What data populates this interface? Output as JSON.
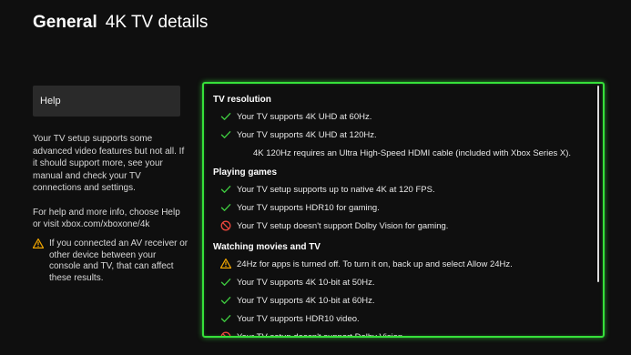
{
  "header": {
    "section": "General",
    "title": "4K TV details"
  },
  "sidebar": {
    "help_label": "Help",
    "paragraph1": "Your TV setup supports some advanced video features but not all. If it should support more, see your manual and check your TV connections and settings.",
    "paragraph2": "For help and more info, choose Help or visit xbox.com/xboxone/4k",
    "warning": "If you connected an AV receiver or other device between your console and TV, that can affect these results."
  },
  "groups": [
    {
      "title": "TV resolution",
      "items": [
        {
          "icon": "check",
          "text": "Your TV supports 4K UHD at 60Hz."
        },
        {
          "icon": "check",
          "text": "Your TV supports 4K UHD at 120Hz."
        },
        {
          "icon": "none",
          "text": "4K 120Hz requires an Ultra High-Speed HDMI cable (included with Xbox Series X)."
        }
      ]
    },
    {
      "title": "Playing games",
      "items": [
        {
          "icon": "check",
          "text": "Your TV setup supports up to native 4K at 120 FPS."
        },
        {
          "icon": "check",
          "text": "Your TV supports HDR10 for gaming."
        },
        {
          "icon": "block",
          "text": "Your TV setup doesn't support Dolby Vision for gaming."
        }
      ]
    },
    {
      "title": "Watching movies and TV",
      "items": [
        {
          "icon": "warning",
          "text": "24Hz for apps is turned off. To turn it on, back up and select Allow 24Hz."
        },
        {
          "icon": "check",
          "text": "Your TV supports 4K 10-bit at 50Hz."
        },
        {
          "icon": "check",
          "text": "Your TV supports 4K 10-bit at 60Hz."
        },
        {
          "icon": "check",
          "text": "Your TV supports HDR10 video."
        },
        {
          "icon": "block",
          "text": "Your TV setup doesn't support Dolby Vision."
        }
      ]
    }
  ],
  "colors": {
    "accent": "#36e03a",
    "check": "#3ec93f",
    "block": "#e8463c",
    "warning": "#f0a500"
  }
}
